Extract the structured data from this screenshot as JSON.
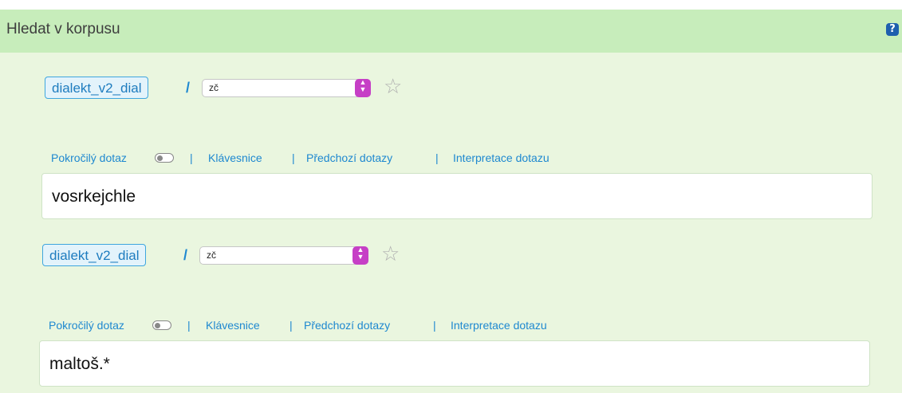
{
  "panel": {
    "title": "Hledat v korpusu",
    "help_icon": "question-mark-icon",
    "help_glyph": "?"
  },
  "queries": [
    {
      "corpus": "dialekt_v2_dial",
      "separator": "/",
      "subcorpus": "zč",
      "favorite_icon": "star-icon",
      "links": {
        "advanced": "Pokročilý dotaz",
        "keyboard": "Klávesnice",
        "history": "Předchozí dotazy",
        "interpretation": "Interpretace dotazu"
      },
      "query_text": "vosrkejchle"
    },
    {
      "corpus": "dialekt_v2_dial",
      "separator": "/",
      "subcorpus": "zč",
      "favorite_icon": "star-icon",
      "links": {
        "advanced": "Pokročilý dotaz",
        "keyboard": "Klávesnice",
        "history": "Předchozí dotazy",
        "interpretation": "Interpretace dotazu"
      },
      "query_text": "maltoš.*"
    }
  ],
  "colors": {
    "accent": "#1e88d0",
    "header_bg": "#c7edbb",
    "panel_bg": "#eaf6df",
    "select_arrow": "#c63fc6"
  }
}
